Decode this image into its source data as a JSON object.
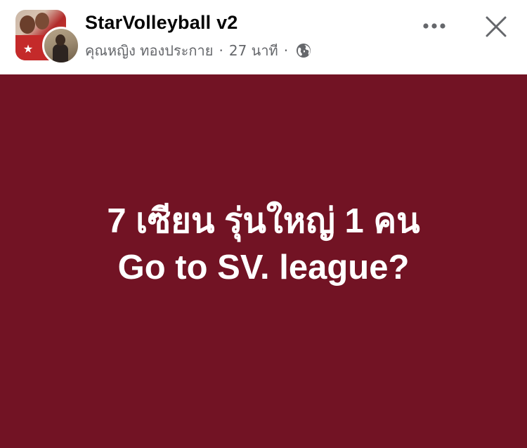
{
  "header": {
    "page_name": "StarVolleyball v2",
    "author": "คุณหญิง ทองประกาย",
    "separator": "·",
    "time_ago": "27 นาที",
    "privacy_icon": "globe-icon",
    "more_icon": "more-dots-icon",
    "close_icon": "close-icon"
  },
  "post": {
    "line1": "7 เซียน รุ่นใหญ่ 1 คน",
    "line2": "Go to SV. league?",
    "background_color": "#721324",
    "text_color": "#ffffff"
  },
  "colors": {
    "title": "#050505",
    "meta": "#65676b",
    "icon": "#65676b"
  }
}
